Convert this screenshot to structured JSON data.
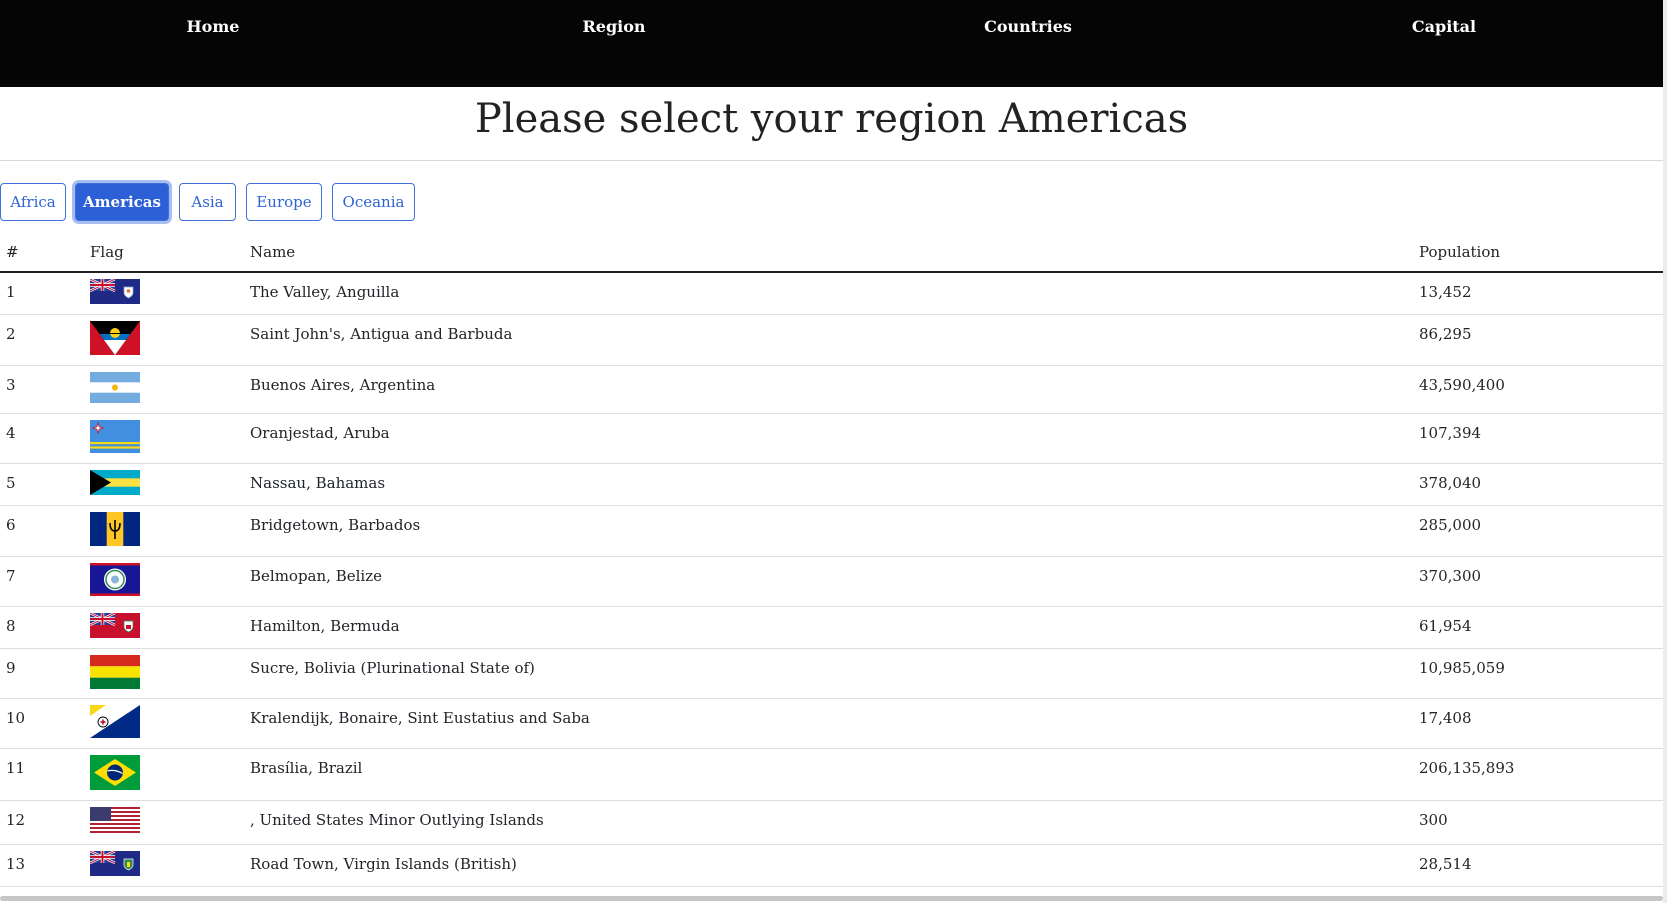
{
  "nav": {
    "home": "Home",
    "region": "Region",
    "countries": "Countries",
    "capital": "Capital"
  },
  "page_title": "Please select your region Americas",
  "regions": [
    "Africa",
    "Americas",
    "Asia",
    "Europe",
    "Oceania"
  ],
  "selected_region": "Americas",
  "table": {
    "headers": [
      "#",
      "Flag",
      "Name",
      "Population"
    ],
    "rows": [
      {
        "num": "1",
        "name": "The Valley, Anguilla",
        "population": "13,452",
        "flag": "anguilla-flag-icon"
      },
      {
        "num": "2",
        "name": "Saint John's, Antigua and Barbuda",
        "population": "86,295",
        "flag": "antigua-and-barbuda-flag-icon"
      },
      {
        "num": "3",
        "name": "Buenos Aires, Argentina",
        "population": "43,590,400",
        "flag": "argentina-flag-icon"
      },
      {
        "num": "4",
        "name": "Oranjestad, Aruba",
        "population": "107,394",
        "flag": "aruba-flag-icon"
      },
      {
        "num": "5",
        "name": "Nassau, Bahamas",
        "population": "378,040",
        "flag": "bahamas-flag-icon"
      },
      {
        "num": "6",
        "name": "Bridgetown, Barbados",
        "population": "285,000",
        "flag": "barbados-flag-icon"
      },
      {
        "num": "7",
        "name": "Belmopan, Belize",
        "population": "370,300",
        "flag": "belize-flag-icon"
      },
      {
        "num": "8",
        "name": "Hamilton, Bermuda",
        "population": "61,954",
        "flag": "bermuda-flag-icon"
      },
      {
        "num": "9",
        "name": "Sucre, Bolivia (Plurinational State of)",
        "population": "10,985,059",
        "flag": "bolivia-flag-icon"
      },
      {
        "num": "10",
        "name": "Kralendijk, Bonaire, Sint Eustatius and Saba",
        "population": "17,408",
        "flag": "bonaire-flag-icon"
      },
      {
        "num": "11",
        "name": "Brasília, Brazil",
        "population": "206,135,893",
        "flag": "brazil-flag-icon"
      },
      {
        "num": "12",
        "name": ", United States Minor Outlying Islands",
        "population": "300",
        "flag": "united-states-minor-outlying-islands-flag-icon"
      },
      {
        "num": "13",
        "name": "Road Town, Virgin Islands (British)",
        "population": "28,514",
        "flag": "british-virgin-islands-flag-icon"
      }
    ]
  },
  "colors": {
    "navbar_bg": "#050505",
    "button_accent": "#2d5fd6"
  }
}
